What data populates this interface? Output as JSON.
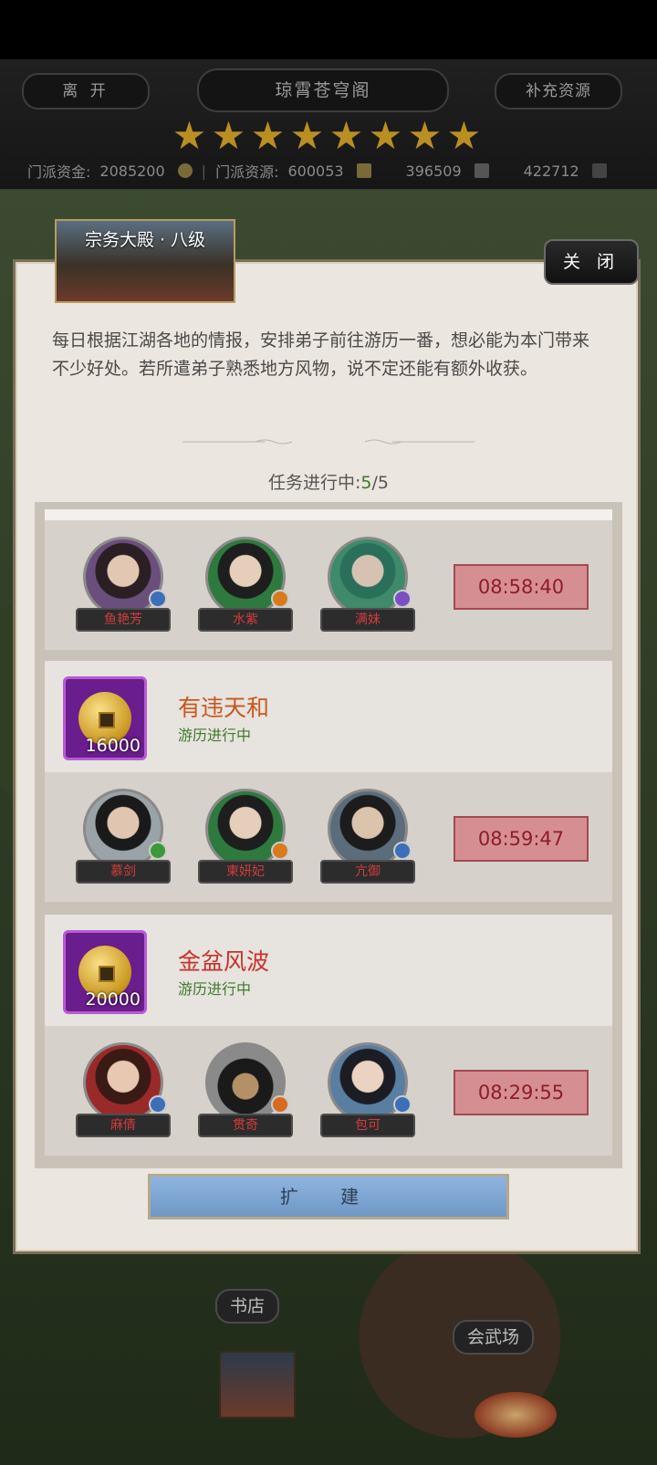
{
  "header": {
    "leave_label": "离 开",
    "title": "琼霄苍穹阁",
    "supply_label": "补充资源",
    "stars": 8,
    "sect_funds_label": "门派资金:",
    "sect_funds_value": "2085200",
    "sect_resource_label": "门派资源:",
    "sect_resource_value": "600053",
    "res2_value": "396509",
    "res3_value": "422712"
  },
  "panel": {
    "banner_title": "宗务大殿 · 八级",
    "close_label": "关 闭",
    "description": "每日根据江湖各地的情报，安排弟子前往游历一番，想必能为本门带来不少好处。若所遣弟子熟悉地方风物，说不定还能有额外收获。",
    "progress_label": "任务进行中:",
    "progress_done": "5",
    "progress_total": "/5",
    "expand_label": "扩 建"
  },
  "missions": [
    {
      "heroes": [
        "鱼艳芳",
        "水紫",
        "满妹"
      ],
      "timer": "08:58:40"
    },
    {
      "title": "有违天和",
      "status": "游历进行中",
      "reward": "16000",
      "heroes": [
        "慕剑",
        "柬妍妃",
        "亢御"
      ],
      "timer": "08:59:47"
    },
    {
      "title": "金盆风波",
      "status": "游历进行中",
      "reward": "20000",
      "heroes": [
        "麻倩",
        "贯奇",
        "包可"
      ],
      "timer": "08:29:55"
    }
  ],
  "map": {
    "bookstore": "书店",
    "arena": "会武场"
  },
  "colors": {
    "title_orange": "#c9571f",
    "title_red": "#c8322c",
    "status_green": "#3e7b2c",
    "timer_bg": "#d58f93",
    "timer_text": "#8e1d26"
  }
}
